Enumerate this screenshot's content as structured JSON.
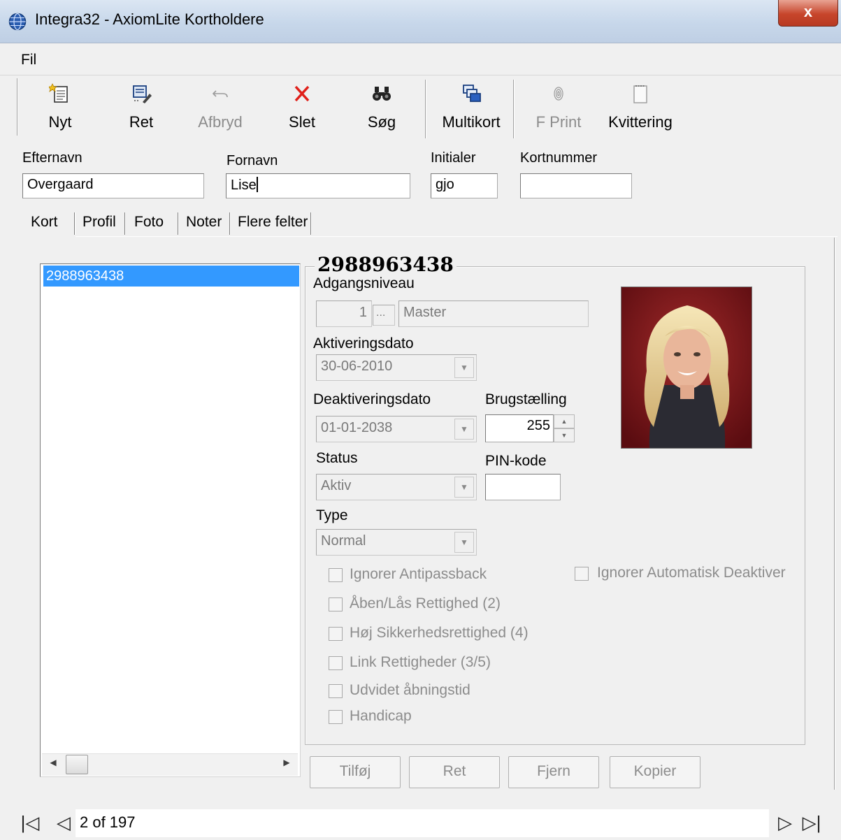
{
  "window": {
    "title": "Integra32 - AxiomLite Kortholdere",
    "close_label": "x"
  },
  "menu": {
    "items": [
      "Fil"
    ]
  },
  "toolbar": {
    "new_label": "Nyt",
    "edit_label": "Ret",
    "cancel_label": "Afbryd",
    "delete_label": "Slet",
    "search_label": "Søg",
    "multicard_label": "Multikort",
    "fprint_label": "F Print",
    "receipt_label": "Kvittering"
  },
  "form": {
    "lastname_label": "Efternavn",
    "lastname_value": "Overgaard",
    "firstname_label": "Fornavn",
    "firstname_value": "Lise",
    "initials_label": "Initialer",
    "initials_value": "gjo",
    "cardnumber_label": "Kortnummer",
    "cardnumber_value": ""
  },
  "tabs": [
    "Kort",
    "Profil",
    "Foto",
    "Noter",
    "Flere felter"
  ],
  "cards": {
    "items": [
      "2988963438"
    ]
  },
  "card_detail": {
    "title": "2988963438",
    "access_level_label": "Adgangsniveau",
    "access_level_number": "1",
    "access_level_browse": "...",
    "access_level_name": "Master",
    "activation_label": "Aktiveringsdato",
    "activation_value": "30-06-2010",
    "deactivation_label": "Deaktiveringsdato",
    "deactivation_value": "01-01-2038",
    "usage_label": "Brugstælling",
    "usage_value": "255",
    "status_label": "Status",
    "status_value": "Aktiv",
    "pin_label": "PIN-kode",
    "pin_value": "",
    "type_label": "Type",
    "type_value": "Normal",
    "checkboxes": [
      "Ignorer Antipassback",
      "Åben/Lås Rettighed (2)",
      "Høj Sikkerhedsrettighed (4)",
      "Link Rettigheder (3/5)",
      "Udvidet åbningstid",
      "Handicap"
    ],
    "auto_deactivate_label": "Ignorer Automatisk Deaktiver"
  },
  "buttons": {
    "add": "Tilføj",
    "edit": "Ret",
    "remove": "Fjern",
    "copy": "Kopier"
  },
  "navigation": {
    "record_text": "2 of 197"
  }
}
